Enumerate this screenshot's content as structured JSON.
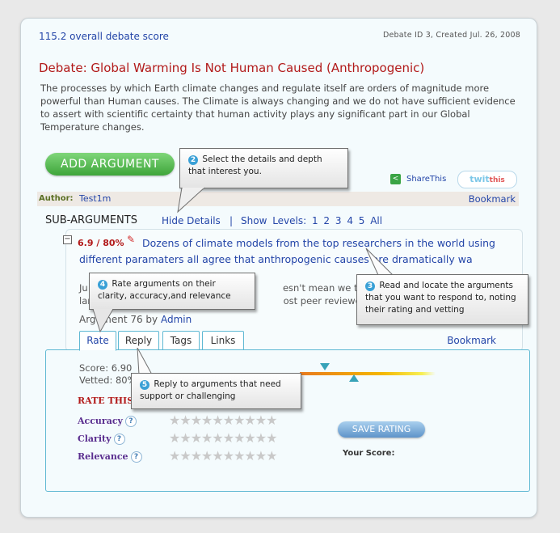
{
  "header": {
    "overall_score": "115.2 overall debate score",
    "debate_id": "Debate ID 3, Created Jul. 26, 2008"
  },
  "debate": {
    "title": "Debate: Global Warming Is Not Human Caused (Anthropogenic)",
    "description": "The processes by which Earth climate changes and regulate itself are orders of magnitude more powerful than Human causes.  The Climate is always changing and we do not have sufficient evidence to assert with scientific certainty that human activity plays any significant part in our Global Temperature changes."
  },
  "actions": {
    "add_argument": "ADD ARGUMENT",
    "share_this": "ShareThis",
    "twit": "twit",
    "twit_this": "this"
  },
  "author": {
    "label": "Author:",
    "name": "Test1m",
    "bookmark": "Bookmark"
  },
  "sub_arguments": {
    "heading": "SUB-ARGUMENTS",
    "hide_details": "Hide Details",
    "separator": "|",
    "show_levels": "Show Levels: 1 2 3 4 5 All"
  },
  "argument": {
    "score": "6.9",
    "percent": "/ 80%",
    "title": "Dozens of climate models from the top researchers in the world using different paramaters all agree that anthropogenic causes are dramatically wa",
    "body_line1": "Ju                                                                  esn't mean we throw",
    "body_line2": "lar                                                                 ost peer reviewed res",
    "meta_prefix": "Argument 76 by",
    "meta_author": "Admin",
    "tabs": [
      "Rate",
      "Reply",
      "Tags",
      "Links"
    ],
    "bookmark": "Bookmark"
  },
  "rating": {
    "score_line": "Score: 6.90",
    "vetted_line": "Vetted: 80%",
    "rate_this": "RATE THIS A",
    "criteria": [
      "Accuracy",
      "Clarity",
      "Relevance"
    ],
    "stars": "★★★★★★★★★★",
    "save_button": "SAVE RATING",
    "your_score": "Your Score:"
  },
  "callouts": {
    "c2_num": "2",
    "c2_text": "Select the details and depth that interest you.",
    "c3_num": "3",
    "c3_text": "Read and locate the arguments that you want to respond to, noting their rating and vetting",
    "c4_num": "4",
    "c4_text": "Rate arguments on their clarity, accuracy,and relevance",
    "c5_num": "5",
    "c5_text": "Reply to arguments that need support or challenging"
  },
  "colors": {
    "accent_blue": "#2345a8",
    "title_red": "#b21a1a",
    "panel_border": "#5fb8d3",
    "add_green": "#3ea53a"
  }
}
